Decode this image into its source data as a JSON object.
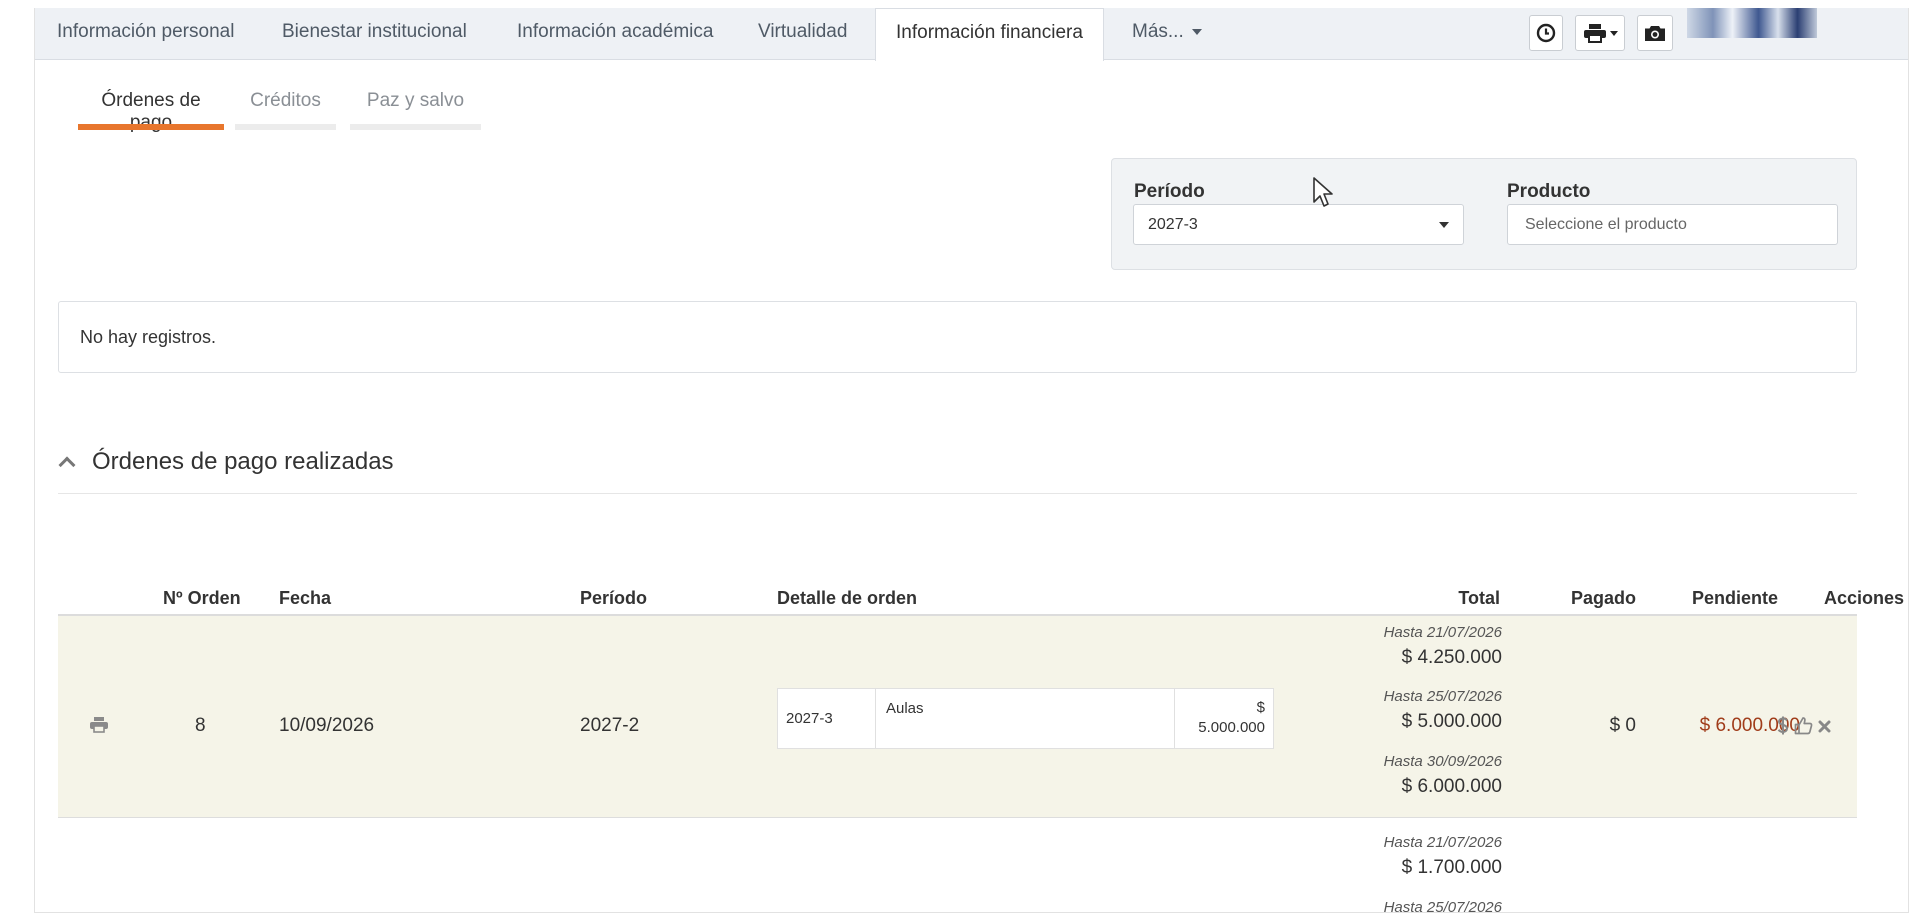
{
  "top_tabs": [
    {
      "label": "Información personal"
    },
    {
      "label": "Bienestar institucional"
    },
    {
      "label": "Información académica"
    },
    {
      "label": "Virtualidad"
    },
    {
      "label": "Información financiera"
    },
    {
      "label": "Más..."
    }
  ],
  "toolbar": {
    "history_icon": "clock-icon",
    "print_icon": "printer-icon",
    "camera_icon": "camera-icon"
  },
  "sub_tabs": [
    {
      "label": "Órdenes de pago"
    },
    {
      "label": "Créditos"
    },
    {
      "label": "Paz y salvo"
    }
  ],
  "filters": {
    "period_label": "Período",
    "period_value": "2027-3",
    "product_label": "Producto",
    "product_placeholder": "Seleccione el producto"
  },
  "no_records": "No hay registros.",
  "section": {
    "title": "Órdenes de pago realizadas"
  },
  "table": {
    "headers": {
      "order": "Nº Orden",
      "date": "Fecha",
      "period": "Período",
      "detail": "Detalle de orden",
      "total": "Total",
      "paid": "Pagado",
      "pending": "Pendiente",
      "actions": "Acciones"
    },
    "rows": [
      {
        "order": "8",
        "date": "10/09/2026",
        "period": "2027-2",
        "detail": {
          "period": "2027-3",
          "concept": "Aulas",
          "currency": "$",
          "amount": "5.000.000"
        },
        "totals": [
          {
            "label": "Hasta 21/07/2026",
            "amount": "$ 4.250.000"
          },
          {
            "label": "Hasta 25/07/2026",
            "amount": "$ 5.000.000"
          },
          {
            "label": "Hasta 30/09/2026",
            "amount": "$ 6.000.000"
          }
        ],
        "paid": "$ 0",
        "pending": "$ 6.000.000"
      },
      {
        "totals": [
          {
            "label": "Hasta 21/07/2026",
            "amount": "$ 1.700.000"
          },
          {
            "label": "Hasta 25/07/2026",
            "amount": ""
          }
        ]
      }
    ]
  },
  "colors": {
    "accent": "#e8762d",
    "pending": "#a03c1a",
    "row_highlight": "#f5f4e8"
  }
}
